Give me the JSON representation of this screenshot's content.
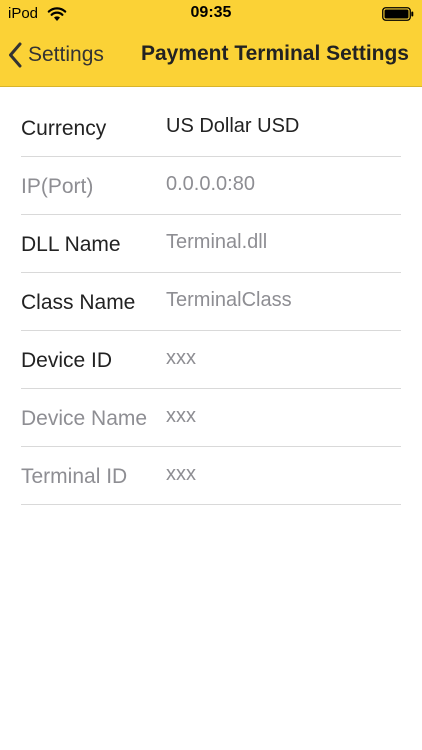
{
  "status_bar": {
    "carrier": "iPod",
    "time": "09:35",
    "wifi_icon": "wifi-icon",
    "battery_icon": "battery-full-icon"
  },
  "nav": {
    "back_label": "Settings",
    "title": "Payment Terminal Settings",
    "back_icon": "chevron-left-icon"
  },
  "colors": {
    "nav_background": "#fbd236",
    "active_text": "#222222",
    "muted_text": "#8e8e93",
    "separator": "#d9d9d9"
  },
  "rows": [
    {
      "label": "Currency",
      "value": "US Dollar USD",
      "enabled": true
    },
    {
      "label": "IP(Port)",
      "value": "0.0.0.0:80",
      "enabled": false
    },
    {
      "label": "DLL Name",
      "value": "Terminal.dll",
      "enabled": true
    },
    {
      "label": "Class Name",
      "value": "TerminalClass",
      "enabled": true
    },
    {
      "label": "Device ID",
      "value": "xxx",
      "enabled": true
    },
    {
      "label": "Device Name",
      "value": "xxx",
      "enabled": false
    },
    {
      "label": "Terminal ID",
      "value": "xxx",
      "enabled": false
    }
  ]
}
